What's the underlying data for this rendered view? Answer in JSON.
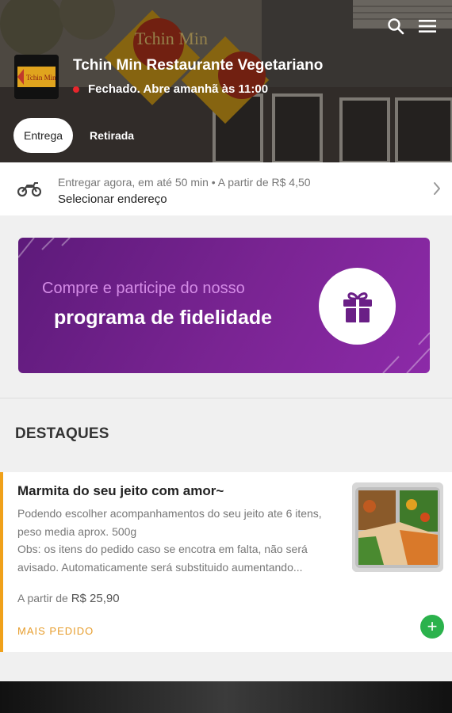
{
  "restaurant": {
    "name": "Tchin Min Restaurante Vegetariano",
    "status": "Fechado. Abre amanhã às 11:00",
    "logo_text": "Tchin Min",
    "sign_text": "Tchin Min"
  },
  "mode_tabs": [
    {
      "label": "Entrega",
      "active": true
    },
    {
      "label": "Retirada",
      "active": false
    }
  ],
  "delivery": {
    "line1": "Entregar agora, em até 50 min • A partir de R$ 4,50",
    "address_label": "Selecionar endereço"
  },
  "banner": {
    "line1": "Compre e participe do nosso",
    "line2": "programa de fidelidade"
  },
  "section": {
    "title": "DESTAQUES"
  },
  "product": {
    "title": "Marmita do seu jeito com amor~",
    "description": "Podendo escolher acompanhamentos do seu jeito ate 6 itens, peso media aprox. 500g\nObs: os itens do pedido caso se encotra em falta, não será avisado. Automaticamente será substituido aumentando...",
    "price_prefix": "A partir de",
    "price": "R$ 25,90",
    "badge": "MAIS PEDIDO",
    "add_symbol": "+"
  },
  "colors": {
    "accent": "#f0a11a",
    "badge": "#e79d2c",
    "add_button": "#2bb24c",
    "banner_purple": "#7a2493",
    "status_dot": "#e8262c"
  },
  "icons": [
    "search-icon",
    "menu-icon",
    "motorcycle-icon",
    "chevron-right-icon",
    "gift-icon",
    "plus-icon"
  ]
}
